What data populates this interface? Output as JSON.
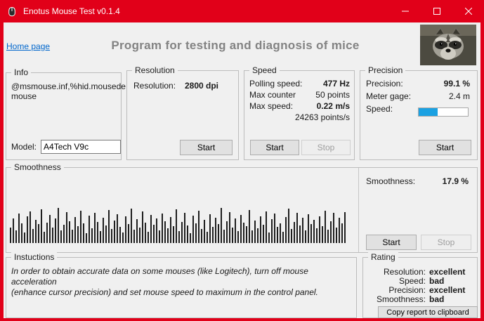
{
  "window": {
    "title": "Enotus Mouse Test v0.1.4"
  },
  "header": {
    "home_link": "Home page",
    "heading": "Program for testing and diagnosis of mice"
  },
  "info": {
    "legend": "Info",
    "device_line1": "@msmouse.inf,%hid.mousede",
    "device_line2": "mouse",
    "model_label": "Model:",
    "model_value": "A4Tech V9c"
  },
  "resolution": {
    "legend": "Resolution",
    "label": "Resolution:",
    "value": "2800 dpi",
    "start": "Start"
  },
  "speed": {
    "legend": "Speed",
    "rows": [
      {
        "label": "Polling speed:",
        "value": "477 Hz"
      },
      {
        "label": "Max counter",
        "value": "50 points"
      },
      {
        "label": "Max speed:",
        "value": "0.22 m/s"
      }
    ],
    "points_rate": "24263 points/s",
    "start": "Start",
    "stop": "Stop"
  },
  "precision": {
    "legend": "Precision",
    "rows": [
      {
        "label": "Precision:",
        "value": "99.1 %"
      },
      {
        "label": "Meter gage:",
        "value": "2.4 m"
      }
    ],
    "speed_label": "Speed:",
    "progress_percent": 38,
    "start": "Start"
  },
  "smoothness": {
    "legend": "Smoothness",
    "label": "Smoothness:",
    "value": "17.9 %",
    "start": "Start",
    "stop": "Stop",
    "bars": [
      22,
      35,
      18,
      42,
      28,
      15,
      38,
      45,
      20,
      33,
      27,
      48,
      16,
      29,
      40,
      22,
      35,
      50,
      18,
      26,
      44,
      31,
      19,
      37,
      24,
      46,
      28,
      14,
      39,
      21,
      43,
      30,
      17,
      36,
      25,
      47,
      20,
      32,
      41,
      23,
      15,
      38,
      27,
      49,
      19,
      34,
      22,
      45,
      29,
      16,
      40,
      26,
      35,
      18,
      42,
      31,
      21,
      37,
      24,
      48,
      17,
      30,
      43,
      25,
      14,
      39,
      28,
      46,
      20,
      33,
      16,
      41,
      23,
      36,
      27,
      50,
      19,
      31,
      44,
      22,
      35,
      17,
      40,
      29,
      24,
      47,
      18,
      32,
      21,
      38,
      26,
      45,
      15,
      34,
      42,
      23,
      28,
      16,
      37,
      49,
      20,
      30,
      43,
      25,
      36,
      18,
      41,
      27,
      33,
      21,
      38,
      24,
      46,
      19,
      31,
      43,
      22,
      36,
      28,
      44
    ]
  },
  "instructions": {
    "legend": "Instuctions",
    "line1": "In order to obtain accurate data on some mouses (like Logitech), turn off mouse acceleration",
    "line2": "(enhance cursor precision) and set mouse speed to maximum in the control panel."
  },
  "rating": {
    "legend": "Rating",
    "rows": [
      {
        "label": "Resolution:",
        "value": "excellent"
      },
      {
        "label": "Speed:",
        "value": "bad"
      },
      {
        "label": "Precision:",
        "value": "excellent"
      },
      {
        "label": "Smoothness:",
        "value": "bad"
      }
    ],
    "copy_button": "Copy report to clipboard"
  },
  "colors": {
    "titlebar_red": "#e10019",
    "progress_fill": "#1ba1e2",
    "link_blue": "#0066cc"
  }
}
